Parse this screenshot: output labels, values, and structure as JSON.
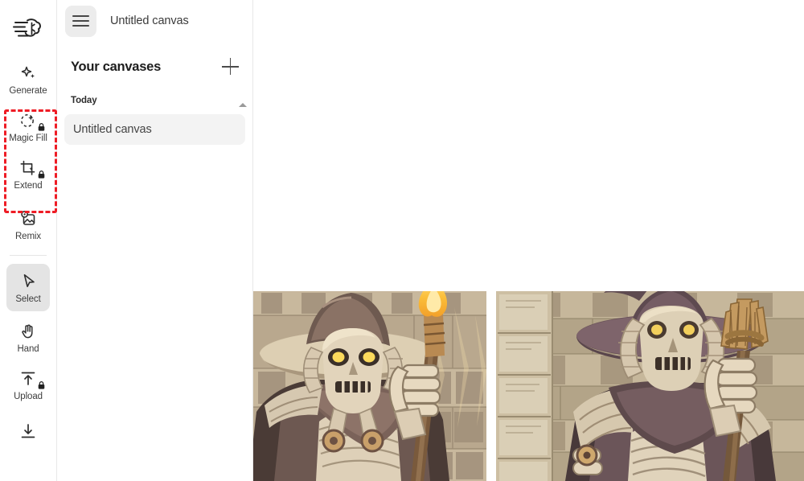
{
  "app": {
    "logo_icon": "brain-speed-logo"
  },
  "rail": {
    "tools": [
      {
        "label": "Generate",
        "icon": "sparkles-icon",
        "locked": false,
        "active": false
      },
      {
        "label": "Magic Fill",
        "icon": "magic-fill-icon",
        "locked": true,
        "active": false
      },
      {
        "label": "Extend",
        "icon": "extend-crop-icon",
        "locked": true,
        "active": false
      },
      {
        "label": "Remix",
        "icon": "remix-image-icon",
        "locked": false,
        "active": false
      },
      {
        "label": "Select",
        "icon": "cursor-arrow-icon",
        "locked": false,
        "active": true
      },
      {
        "label": "Hand",
        "icon": "hand-icon",
        "locked": false,
        "active": false
      },
      {
        "label": "Upload",
        "icon": "upload-arrow-icon",
        "locked": true,
        "active": false
      },
      {
        "label": "Download",
        "icon": "download-arrow-icon",
        "locked": false,
        "active": false
      }
    ]
  },
  "panel": {
    "menu_icon": "hamburger-menu-icon",
    "document_title": "Untitled canvas",
    "section_title": "Your canvases",
    "add_icon": "plus-icon",
    "collapse_icon": "chevron-up-icon",
    "groups": [
      {
        "label": "Today",
        "items": [
          {
            "name": "Untitled canvas",
            "selected": true
          }
        ]
      }
    ]
  },
  "stage": {
    "images": [
      {
        "name": "mummy-wizard-torch-left",
        "alt": "Cartoon mummy skeleton wizard with wide brimmed hat holding a flaming torch"
      },
      {
        "name": "mummy-wizard-broom-right",
        "alt": "Cartoon mummy skeleton wizard with pointed hat in front of stone wall holding a broom"
      }
    ]
  },
  "annotation": {
    "name": "red-dashed-highlight",
    "color": "#ee1c25"
  },
  "colors": {
    "accent_red": "#ee1c25",
    "panel_border": "#e8e8e8",
    "active_tool_bg": "#e4e4e4",
    "row_bg": "#f3f3f3",
    "burger_bg": "#ececec"
  }
}
